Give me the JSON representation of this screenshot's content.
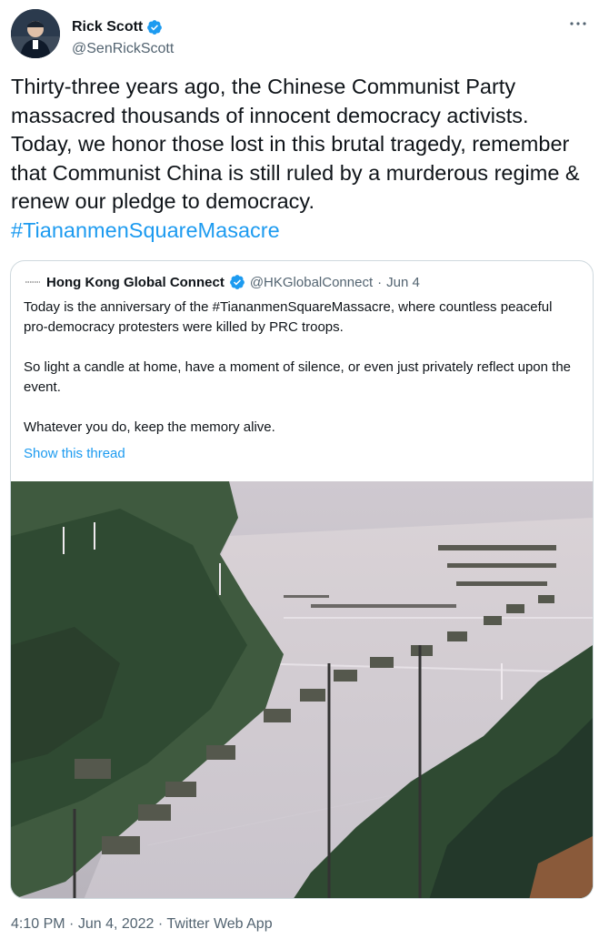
{
  "author": {
    "name": "Rick Scott",
    "handle": "@SenRickScott"
  },
  "tweet": {
    "text": "Thirty-three years ago, the Chinese Communist Party massacred thousands of innocent democracy activists. Today, we honor those lost in this brutal tragedy, remember that Communist China is still ruled by a murderous regime & renew our pledge to democracy.",
    "hashtag": "#TiananmenSquareMasacre"
  },
  "quoted": {
    "name": "Hong Kong Global Connect",
    "handle": "@HKGlobalConnect",
    "separator": "·",
    "date": "Jun 4",
    "paragraphs": [
      "Today is the anniversary of the #TiananmenSquareMassacre, where countless peaceful pro-democracy protesters were killed by PRC troops.",
      "So light a candle at home, have a moment of silence, or even just privately reflect upon the event.",
      "Whatever you do, keep the memory alive."
    ],
    "show_thread": "Show this thread"
  },
  "footer": {
    "time": "4:10 PM",
    "date": "Jun 4, 2022",
    "source": "Twitter Web App",
    "separator": "·"
  },
  "icons": {
    "more": "more-icon",
    "verified": "verified-badge-icon"
  },
  "colors": {
    "accent": "#1d9bf0",
    "text": "#0f1419",
    "secondary": "#536471",
    "border": "#cfd9de"
  }
}
